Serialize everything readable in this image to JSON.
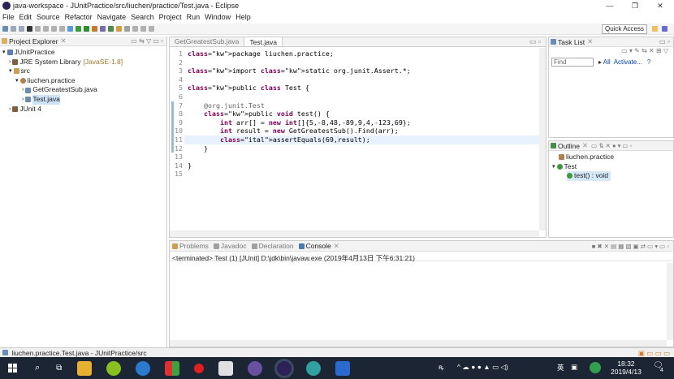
{
  "window": {
    "title": "java-workspace - JUnitPractice/src/liuchen/practice/Test.java - Eclipse"
  },
  "menu": [
    "File",
    "Edit",
    "Source",
    "Refactor",
    "Navigate",
    "Search",
    "Project",
    "Run",
    "Window",
    "Help"
  ],
  "toolbar": {
    "quick_access": "Quick Access"
  },
  "project_explorer": {
    "title": "Project Explorer",
    "items": [
      {
        "label": "JUnitPractice"
      },
      {
        "label": "JRE System Library",
        "suffix": "[JavaSE-1.8]"
      },
      {
        "label": "src"
      },
      {
        "label": "liuchen.practice"
      },
      {
        "label": "GetGreatestSub.java"
      },
      {
        "label": "Test.java"
      },
      {
        "label": "JUnit 4"
      }
    ]
  },
  "editor": {
    "tabs": [
      "GetGreatestSub.java",
      "Test.java"
    ],
    "line_numbers": [
      "1",
      "2",
      "3",
      "4",
      "5",
      "6",
      "7",
      "8",
      "9",
      "10",
      "11",
      "12",
      "13",
      "14",
      "15"
    ],
    "lines": [
      "package liuchen.practice;",
      "",
      "import static org.junit.Assert.*;",
      "",
      "public class Test {",
      "",
      "    @org.junit.Test",
      "    public void test() {",
      "        int arr[] = new int[]{5,-8,48,-89,9,4,-123,69};",
      "        int result = new GetGreatestSub().Find(arr);",
      "        assertEquals(69,result);",
      "    }",
      "",
      "}",
      ""
    ]
  },
  "task_list": {
    "title": "Task List",
    "find_placeholder": "Find",
    "all": "All",
    "activate": "Activate..."
  },
  "outline": {
    "title": "Outline",
    "items": [
      "liuchen.practice",
      "Test",
      "test() : void"
    ]
  },
  "console": {
    "tabs": [
      "Problems",
      "Javadoc",
      "Declaration",
      "Console"
    ],
    "status": "<terminated> Test (1) [JUnit] D:\\jdk\\bin\\javaw.exe (2019年4月13日 下午6:31:21)"
  },
  "statusbar": {
    "text": "liuchen.practice.Test.java - JUnitPractice/src"
  },
  "taskbar": {
    "time": "18:32",
    "date": "2019/4/13",
    "ime": "英",
    "notif_count": "4"
  },
  "colors": {
    "keyword": "#7f0055",
    "annotation": "#646464",
    "taskbar": "#1b2533",
    "selection": "#e8f2fe"
  }
}
